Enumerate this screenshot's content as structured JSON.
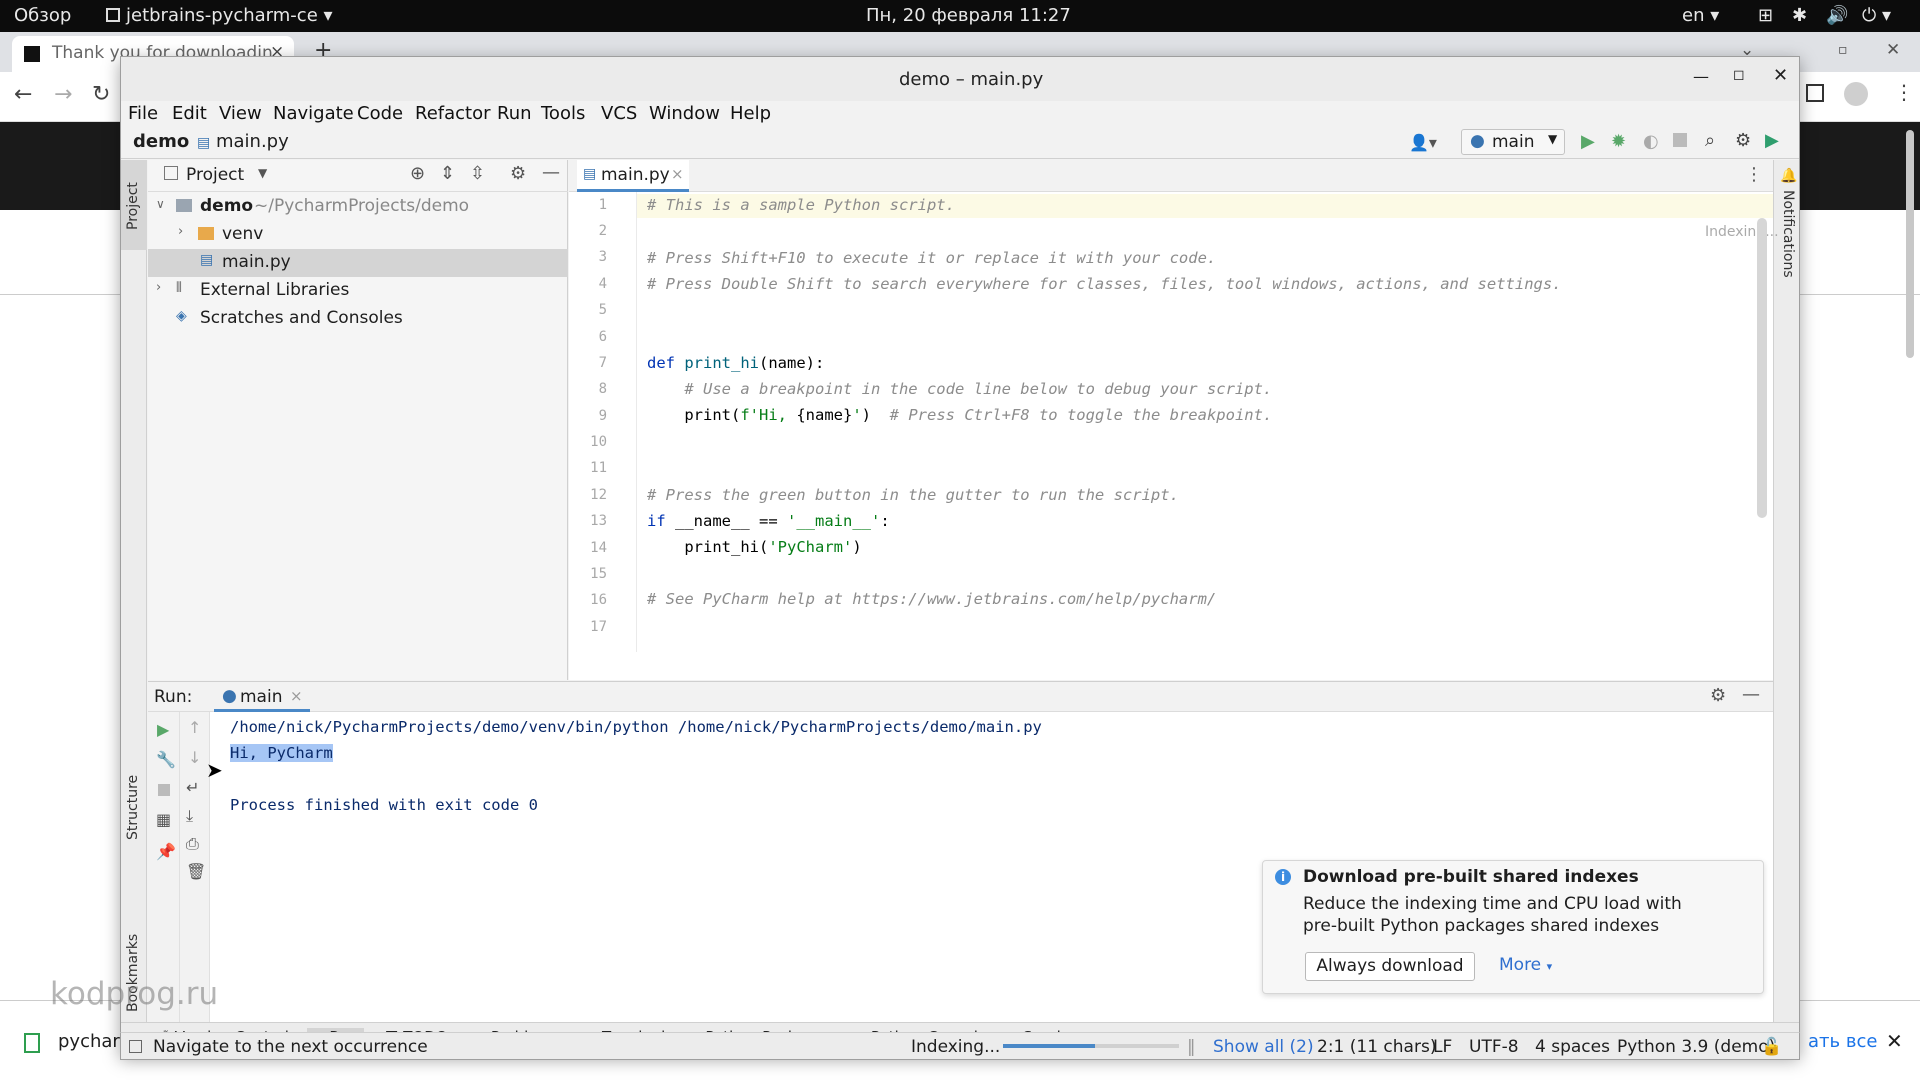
{
  "system": {
    "overview": "Обзор",
    "app_menu": "jetbrains-pycharm-ce",
    "clock": "Пн, 20 февраля  11:27",
    "lang": "en"
  },
  "browser": {
    "tab_title": "Thank you for downloadin",
    "bottom_left": "pychar",
    "bottom_right": "ать все"
  },
  "window": {
    "title": "demo – main.py"
  },
  "menu": [
    "File",
    "Edit",
    "View",
    "Navigate",
    "Code",
    "Refactor",
    "Run",
    "Tools",
    "VCS",
    "Window",
    "Help"
  ],
  "nav": {
    "project": "demo",
    "file": "main.py",
    "run_config": "main"
  },
  "project_panel": {
    "title": "Project",
    "tree": [
      {
        "label": "demo",
        "suffix": "~/PycharmProjects/demo"
      },
      {
        "label": "venv"
      },
      {
        "label": "main.py"
      },
      {
        "label": "External Libraries"
      },
      {
        "label": "Scratches and Consoles"
      }
    ]
  },
  "editor": {
    "tab": "main.py",
    "status": "Indexing...",
    "line_numbers": [
      "1",
      "2",
      "3",
      "4",
      "5",
      "6",
      "7",
      "8",
      "9",
      "10",
      "11",
      "12",
      "13",
      "14",
      "15",
      "16",
      "17"
    ]
  },
  "run": {
    "label": "Run:",
    "tab": "main",
    "command": "/home/nick/PycharmProjects/demo/venv/bin/python /home/nick/PycharmProjects/demo/main.py",
    "output": "Hi, PyCharm",
    "exit": "Process finished with exit code 0"
  },
  "side_labels": {
    "project": "Project",
    "structure": "Structure",
    "bookmarks": "Bookmarks",
    "notifications": "Notifications"
  },
  "toolbar_bottom": [
    "Version Control",
    "Run",
    "TODO",
    "Problems",
    "Terminal",
    "Python Packages",
    "Python Console",
    "Services"
  ],
  "status": {
    "message": "Navigate to the next occurrence",
    "indexing": "Indexing...",
    "indexing_progress": 0.52,
    "show_all": "Show all (2)",
    "position": "2:1 (11 chars)",
    "line_sep": "LF",
    "encoding": "UTF-8",
    "indent": "4 spaces",
    "interpreter": "Python 3.9 (demo)"
  },
  "notification": {
    "title": "Download pre-built shared indexes",
    "body1": "Reduce the indexing time and CPU load with",
    "body2": "pre-built Python packages shared indexes",
    "button": "Always download",
    "more": "More"
  },
  "watermark": "kodprog.ru",
  "colors": {
    "accent": "#4a88c7",
    "run_green": "#59a869",
    "keyword": "#0033b3",
    "string": "#067d17",
    "comment": "#8c8c8c"
  }
}
